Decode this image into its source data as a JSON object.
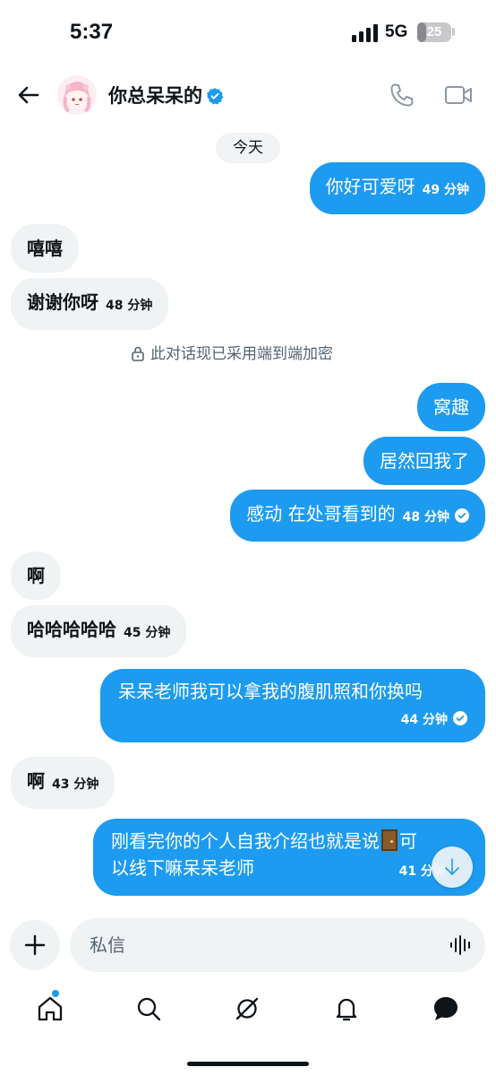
{
  "status_bar": {
    "time": "5:37",
    "network": "5G",
    "battery": "25",
    "battery_level": 0.25
  },
  "header": {
    "title": "你总呆呆的",
    "icons": [
      "back-arrow-icon",
      "verified-badge-icon",
      "phone-icon",
      "video-icon"
    ]
  },
  "chat": {
    "date_label": "今天",
    "encryption_notice": "此对话现已采用端到端加密",
    "messages": [
      {
        "side": "out",
        "text": "你好可爱呀",
        "time": "49 分钟"
      },
      {
        "side": "in",
        "text": "嘻嘻",
        "time": ""
      },
      {
        "side": "in",
        "text": "谢谢你呀",
        "time": "48 分钟"
      },
      {
        "side": "out",
        "text": "窝趣",
        "time": ""
      },
      {
        "side": "out",
        "text": "居然回我了",
        "time": ""
      },
      {
        "side": "out",
        "text": "感动 在处哥看到的",
        "time": "48 分钟",
        "read": true
      },
      {
        "side": "in",
        "text": "啊",
        "time": ""
      },
      {
        "side": "in",
        "text": "哈哈哈哈哈",
        "time": "45 分钟"
      },
      {
        "side": "out",
        "text": "呆呆老师我可以拿我的腹肌照和你换吗",
        "time": "44 分钟",
        "read": true
      },
      {
        "side": "in",
        "text": "啊",
        "time": "43 分钟"
      },
      {
        "side": "out",
        "text_line1_a": "刚看完你的个人自我介绍也就是说",
        "text_line1_b": "可",
        "text_line2": "以线下嘛呆呆老师",
        "time": "41 分钟",
        "emoji": "door-emoji",
        "read": true
      }
    ]
  },
  "composer": {
    "placeholder": "私信"
  },
  "nav": {
    "items": [
      "home-icon",
      "search-icon",
      "grok-icon",
      "notifications-icon",
      "messages-icon"
    ]
  },
  "colors": {
    "accent": "#1d9bf0",
    "incoming_bubble": "#eff3f4",
    "text": "#0f1419",
    "muted": "#536471"
  }
}
